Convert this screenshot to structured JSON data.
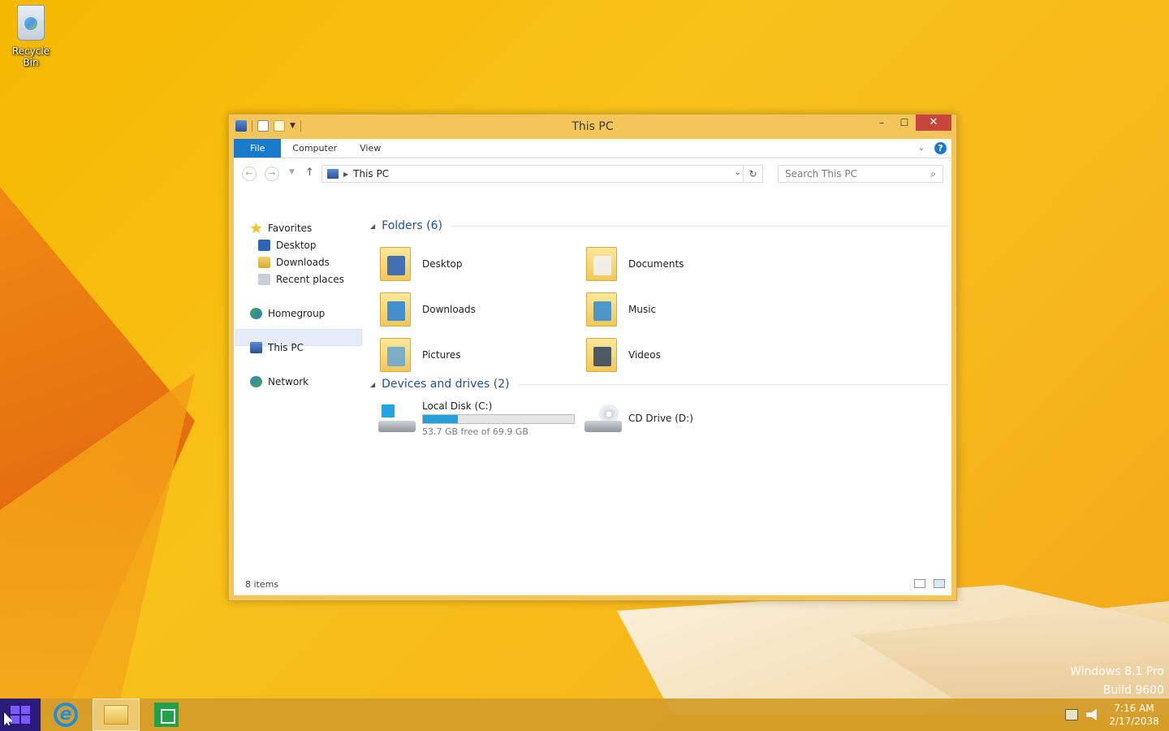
{
  "desktop": {
    "icons": [
      {
        "label": "Recycle Bin",
        "icon": "recycle-bin-icon"
      }
    ],
    "watermark": {
      "line1": "Windows 8.1 Pro",
      "line2": "Build 9600"
    }
  },
  "window": {
    "title": "This PC",
    "controls": {
      "minimize": "–",
      "maximize": "☐",
      "close": "✕"
    },
    "ribbon": {
      "tabs": [
        "File",
        "Computer",
        "View"
      ],
      "help": "?"
    },
    "address": {
      "path": "This PC"
    },
    "search": {
      "placeholder": "Search This PC"
    },
    "sidebar": {
      "favorites": "Favorites",
      "desktop": "Desktop",
      "downloads": "Downloads",
      "recent": "Recent places",
      "homegroup": "Homegroup",
      "this_pc": "This PC",
      "network": "Network"
    },
    "groups": {
      "folders": {
        "header": "Folders (6)",
        "items": [
          "Desktop",
          "Documents",
          "Downloads",
          "Music",
          "Pictures",
          "Videos"
        ]
      },
      "devices": {
        "header": "Devices and drives (2)",
        "local_disk": {
          "name": "Local Disk (C:)",
          "free": "53.7 GB free of 69.9 GB",
          "used_fraction": 0.232
        },
        "cd_drive": {
          "name": "CD Drive (D:)"
        }
      }
    },
    "status": "8 items"
  },
  "taskbar": {
    "apps": [
      "Internet Explorer",
      "File Explorer",
      "Store"
    ],
    "clock": {
      "time": "7:16 AM",
      "date": "2/17/2038"
    }
  },
  "colors": {
    "accent": "#1979ca",
    "window_frame": "#f3c65b",
    "close": "#c7453a",
    "progress": "#26a0da"
  }
}
